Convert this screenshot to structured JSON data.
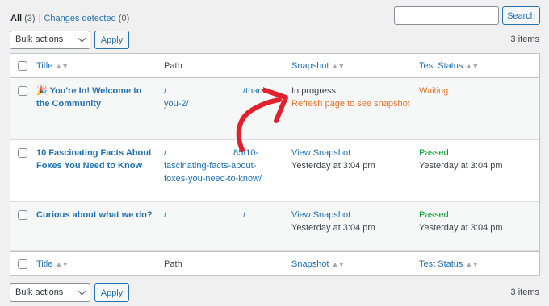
{
  "filters": {
    "all_label": "All",
    "all_count": "(3)",
    "sep": "|",
    "changes_label": "Changes detected",
    "changes_count": "(0)"
  },
  "search": {
    "button": "Search",
    "placeholder": ""
  },
  "tablenav_top": {
    "bulk_label": "Bulk actions",
    "apply": "Apply",
    "count": "3 items"
  },
  "tablenav_bottom": {
    "bulk_label": "Bulk actions",
    "apply": "Apply",
    "count": "3 items"
  },
  "columns": {
    "title": "Title",
    "path": "Path",
    "snapshot": "Snapshot",
    "status": "Test Status"
  },
  "sort_icon": "▲▼",
  "rows": [
    {
      "title_emoji": "🎉",
      "title_line1": "You're In! Welcome to",
      "title_line2": "the Community",
      "path_line1a": "/",
      "path_line1b": "/thank-",
      "path_line2": "you-2/",
      "snap_line1": "In progress",
      "snap_line2": "Refresh page to see snapshot",
      "status": "Waiting",
      "status_color": "#e5752f"
    },
    {
      "title_line1": "10 Fascinating Facts About",
      "title_line2": "Foxes You Need to Know",
      "path_line1a": "/",
      "path_line1b": "85/10-",
      "path_line2": "fascinating-facts-about-",
      "path_line3": "foxes-you-need-to-know/",
      "snap_line1": "View Snapshot",
      "snap_line2": "Yesterday at 3:04 pm",
      "status": "Passed",
      "status_line2": "Yesterday at 3:04 pm",
      "status_color": "#00a32a"
    },
    {
      "title_line1": "Curious about what we do?",
      "path_line1a": "/",
      "path_line1b": "/",
      "snap_line1": "View Snapshot",
      "snap_line2": "Yesterday at 3:04 pm",
      "status": "Passed",
      "status_line2": "Yesterday at 3:04 pm",
      "status_color": "#00a32a"
    }
  ],
  "annotation": {
    "arrow_color": "#e0212c"
  }
}
